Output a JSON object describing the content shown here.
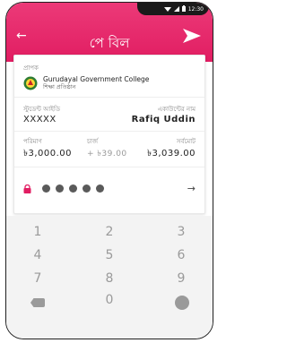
{
  "status": {
    "time": "12:30"
  },
  "header": {
    "title": "পে বিল"
  },
  "card": {
    "sender_label": "প্রাপক",
    "org_name": "Gurudayal Government College",
    "org_subtitle": "শিক্ষা প্রতিষ্ঠান",
    "student_id_label": "স্টুডেন্ট আইডি",
    "student_id_value": "XXXXX",
    "account_name_label": "একাউন্টের নাম",
    "account_name_value": "Rafiq Uddin",
    "amount_label": "পরিমাণ",
    "amount_value": "৳3,000.00",
    "charge_label": "চার্জ",
    "charge_value": "+ ৳39.00",
    "total_label": "সর্বমোট",
    "total_value": "৳3,039.00",
    "pin_digits_filled": 5
  },
  "keypad": {
    "keys": [
      "1",
      "2",
      "3",
      "4",
      "5",
      "6",
      "7",
      "8",
      "9",
      "0"
    ]
  },
  "colors": {
    "brand": "#e11d62"
  }
}
